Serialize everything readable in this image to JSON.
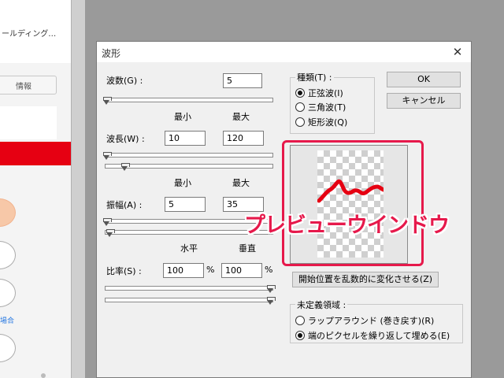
{
  "background_page": {
    "title_fragment": "ールディング…",
    "info_button": "情報",
    "link_fragment": "場合"
  },
  "dialog": {
    "title": "波形",
    "close_glyph": "✕",
    "wave_count": {
      "label": "波数(G) :",
      "value": "5"
    },
    "column_headers": {
      "min": "最小",
      "max": "最大"
    },
    "wavelength": {
      "label": "波長(W) :",
      "min": "10",
      "max": "120"
    },
    "amplitude": {
      "label": "振幅(A) :",
      "min": "5",
      "max": "35"
    },
    "scale_headers": {
      "horizontal": "水平",
      "vertical": "垂直"
    },
    "scale": {
      "label": "比率(S) :",
      "horizontal": "100",
      "vertical": "100",
      "unit": "%"
    },
    "type_group": {
      "title": "種類(T) :",
      "options": [
        {
          "label": "正弦波(I)",
          "selected": true
        },
        {
          "label": "三角波(T)",
          "selected": false
        },
        {
          "label": "矩形波(Q)",
          "selected": false
        }
      ]
    },
    "ok_label": "OK",
    "cancel_label": "キャンセル",
    "randomize_label": "開始位置を乱数的に変化させる(Z)",
    "undefined_group": {
      "title": "未定義領域 :",
      "options": [
        {
          "label": "ラップアラウンド (巻き戻す)(R)",
          "selected": false
        },
        {
          "label": "端のピクセルを繰り返して埋める(E)",
          "selected": true
        }
      ]
    }
  },
  "annotation": {
    "label": "プレビューウインドウ",
    "color": "#e6194b"
  },
  "colors": {
    "wave_stroke": "#e60012"
  }
}
